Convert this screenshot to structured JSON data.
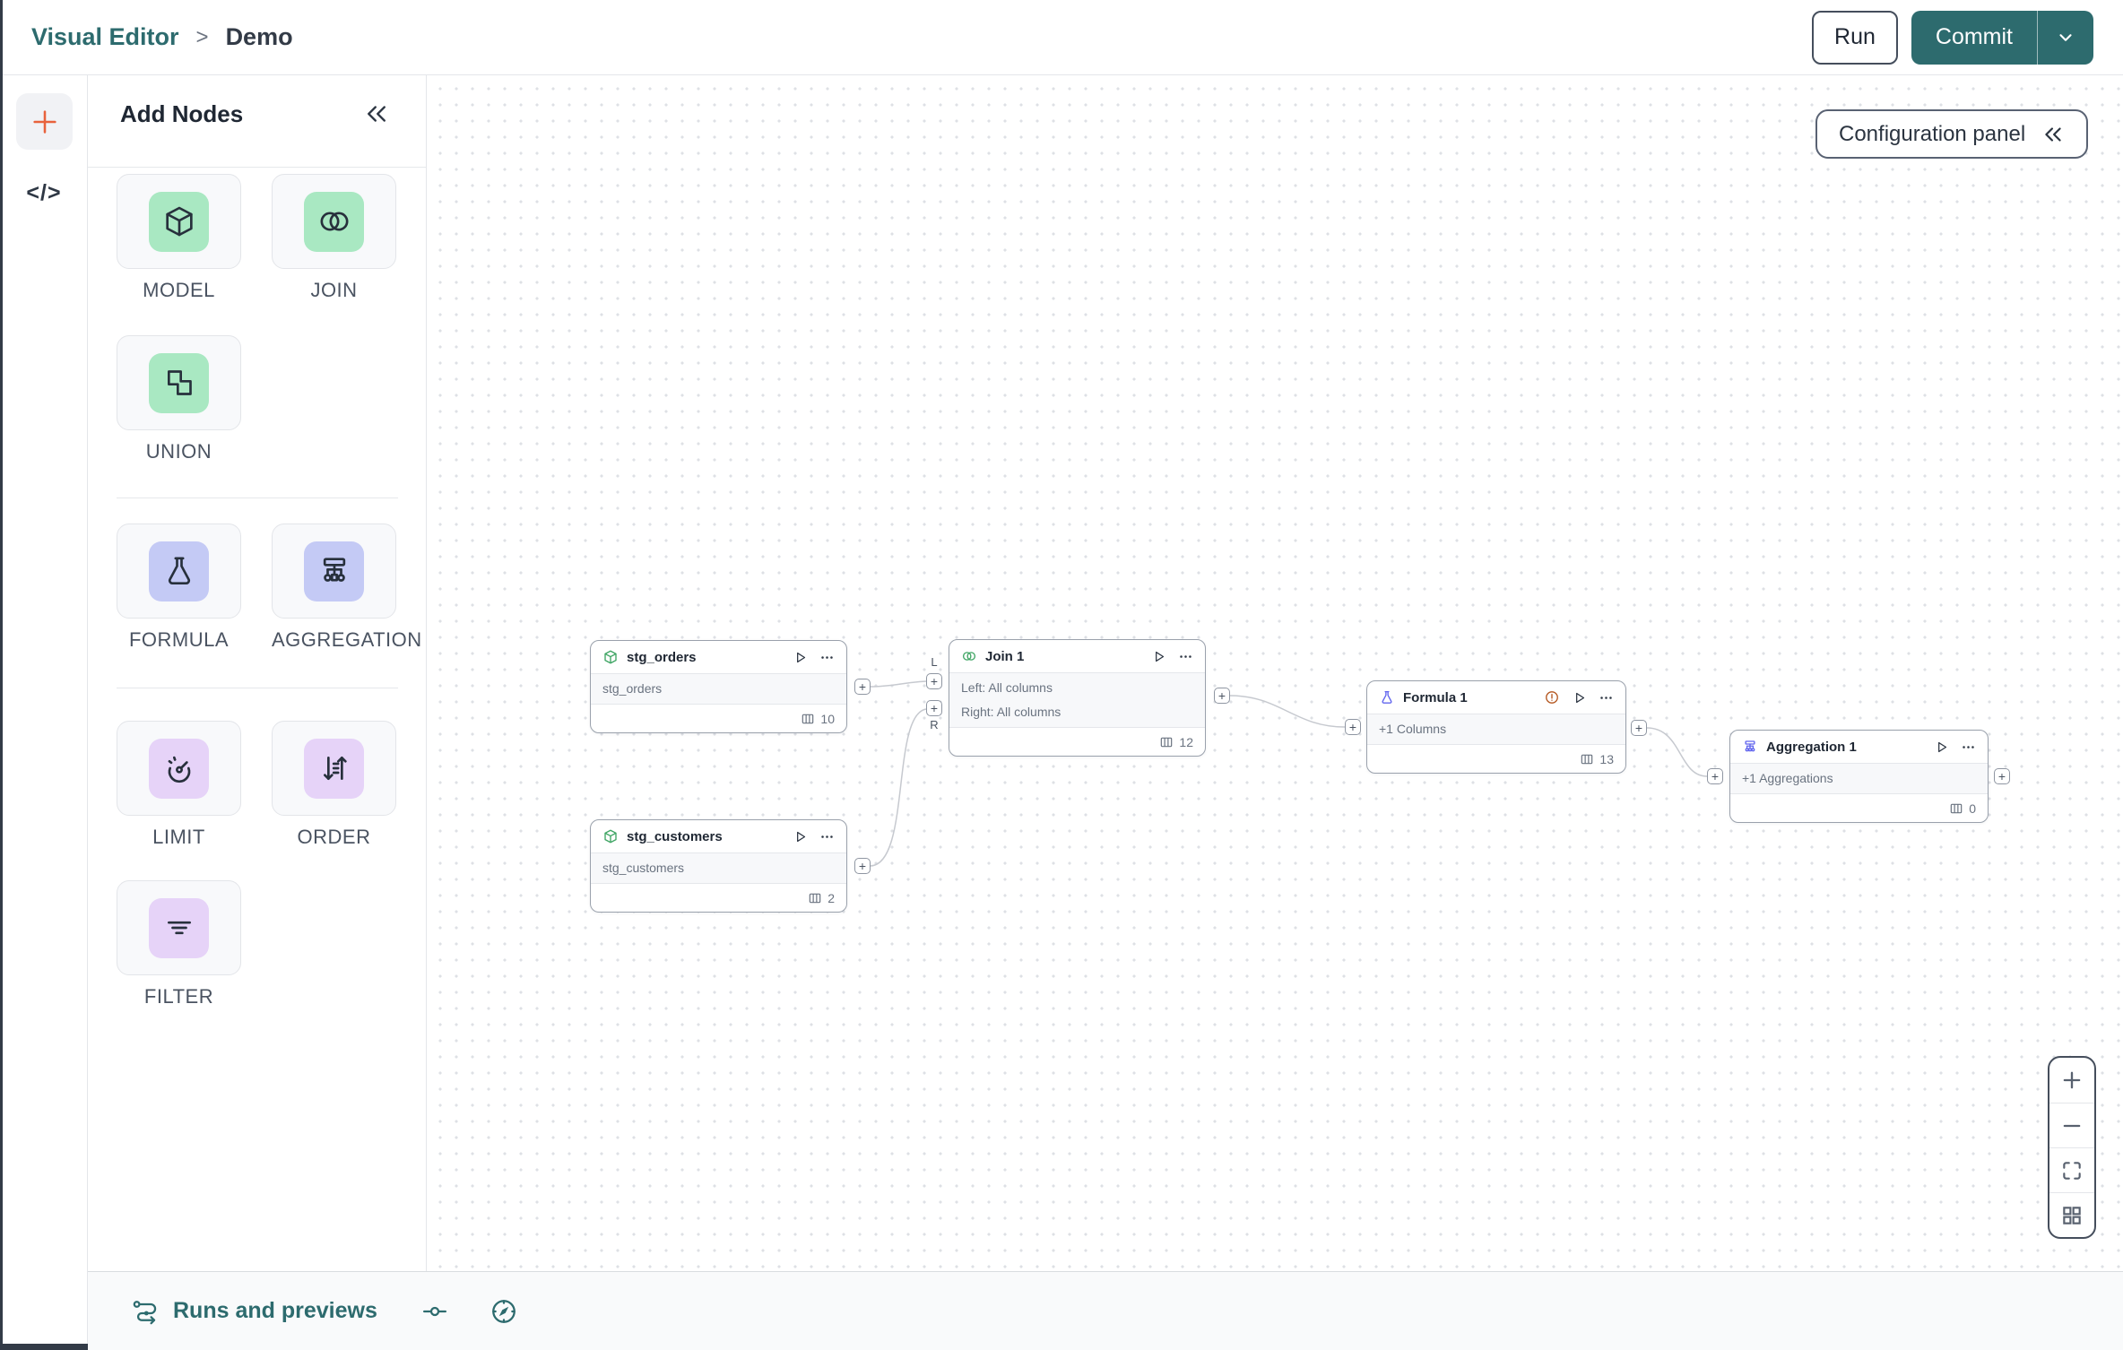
{
  "colors": {
    "teal": "#2D6B6E",
    "orange": "#E8623C",
    "node_icon_green": "#3FA564",
    "node_icon_purple": "#6165EE",
    "warning": "#B4561F",
    "tile_green": "#A9E8C2",
    "tile_violet": "#C4CAF5",
    "tile_lavender": "#E6D3F8"
  },
  "header": {
    "breadcrumb_root": "Visual Editor",
    "breadcrumb_separator": ">",
    "breadcrumb_page": "Demo",
    "run_button": "Run",
    "commit_button": "Commit"
  },
  "left_rail": {
    "code_button": "</>"
  },
  "add_nodes_panel": {
    "title": "Add Nodes",
    "tiles": [
      {
        "label": "MODEL",
        "icon": "cube-icon",
        "color": "green"
      },
      {
        "label": "JOIN",
        "icon": "join-icon",
        "color": "green"
      },
      {
        "label": "UNION",
        "icon": "union-icon",
        "color": "green"
      },
      {
        "label": "FORMULA",
        "icon": "flask-icon",
        "color": "violet"
      },
      {
        "label": "AGGREGATION",
        "icon": "sitemap-icon",
        "color": "violet"
      },
      {
        "label": "LIMIT",
        "icon": "gauge-icon",
        "color": "lavender"
      },
      {
        "label": "ORDER",
        "icon": "sort-icon",
        "color": "lavender"
      },
      {
        "label": "FILTER",
        "icon": "filter-icon",
        "color": "lavender"
      }
    ]
  },
  "canvas": {
    "config_panel_button": "Configuration panel",
    "handle_plus": "+",
    "nodes": [
      {
        "title": "stg_orders",
        "icon": "model-cube-icon",
        "body": [
          "stg_orders"
        ],
        "columns": "10"
      },
      {
        "title": "stg_customers",
        "icon": "model-cube-icon",
        "body": [
          "stg_customers"
        ],
        "columns": "2"
      },
      {
        "title": "Join 1",
        "icon": "join-icon",
        "body": [
          "Left: All columns",
          "Right: All columns"
        ],
        "columns": "12",
        "input_labels": [
          "L",
          "R"
        ]
      },
      {
        "title": "Formula 1",
        "icon": "flask-icon",
        "body": [
          "+1 Columns"
        ],
        "columns": "13",
        "has_warning": true
      },
      {
        "title": "Aggregation 1",
        "icon": "sitemap-icon",
        "body": [
          "+1 Aggregations"
        ],
        "columns": "0"
      }
    ]
  },
  "bottom_bar": {
    "runs_label": "Runs and previews"
  }
}
